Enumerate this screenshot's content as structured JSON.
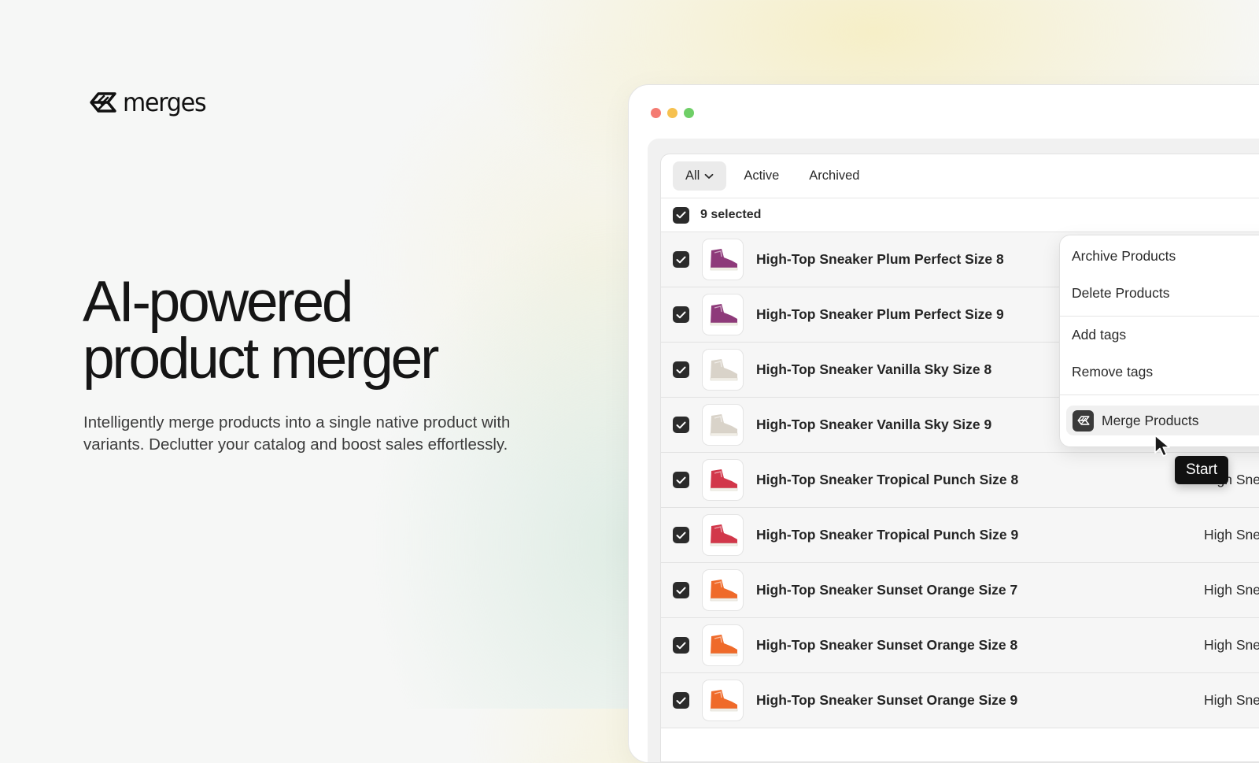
{
  "brand": {
    "name": "merges"
  },
  "hero": {
    "headline_line1": "AI-powered",
    "headline_line2": "product merger",
    "subtext_line1": "Intelligently merge products into a single native product with",
    "subtext_line2": "variants. Declutter your catalog and boost sales effortlessly."
  },
  "tabs": {
    "all": "All",
    "active": "Active",
    "archived": "Archived"
  },
  "selection": {
    "label": "9 selected",
    "checked": true
  },
  "rows": [
    {
      "title": "High-Top Sneaker Plum Perfect Size 8",
      "vendor": "",
      "color": "plum",
      "checked": true
    },
    {
      "title": "High-Top Sneaker Plum Perfect Size 9",
      "vendor": "",
      "color": "plum",
      "checked": true
    },
    {
      "title": "High-Top Sneaker Vanilla Sky Size 8",
      "vendor": "",
      "color": "vanilla",
      "checked": true
    },
    {
      "title": "High-Top Sneaker Vanilla Sky Size 9",
      "vendor": "",
      "color": "vanilla",
      "checked": true
    },
    {
      "title": "High-Top Sneaker Tropical Punch Size 8",
      "vendor": "High Snea",
      "color": "tropical",
      "checked": true
    },
    {
      "title": "High-Top Sneaker Tropical Punch Size 9",
      "vendor": "High Snea",
      "color": "tropical",
      "checked": true
    },
    {
      "title": "High-Top Sneaker Sunset Orange Size 7",
      "vendor": "High Snea",
      "color": "sunset",
      "checked": true
    },
    {
      "title": "High-Top Sneaker Sunset Orange Size 8",
      "vendor": "High Snea",
      "color": "sunset",
      "checked": true
    },
    {
      "title": "High-Top Sneaker Sunset Orange Size 9",
      "vendor": "High Snea",
      "color": "sunset",
      "checked": true
    }
  ],
  "menu": {
    "archive": "Archive Products",
    "delete": "Delete Products",
    "add_tags": "Add tags",
    "remove_tags": "Remove tags",
    "merge": "Merge Products"
  },
  "tooltip": {
    "label": "Start"
  },
  "icons": {
    "logo": "merges-logo-icon",
    "chevron": "chevron-down-icon",
    "check": "check-icon",
    "cursor": "cursor-icon",
    "merge": "merges-logo-icon"
  },
  "colors": {
    "text": "#1a1a1a",
    "checkbox": "#2b2b2b",
    "tooltip_bg": "#111111",
    "plum": "#8e3a7a",
    "vanilla": "#d9d3c9",
    "tropical": "#d2374a",
    "sunset": "#ef6a2a"
  }
}
